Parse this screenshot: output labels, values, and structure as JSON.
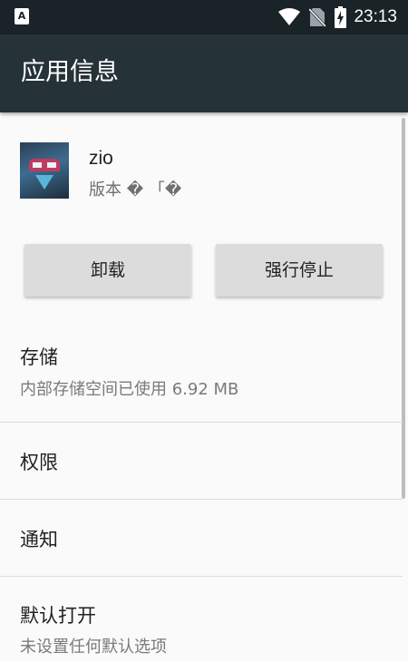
{
  "status_bar": {
    "notification": "A",
    "time": "23:13"
  },
  "app_bar": {
    "title": "应用信息"
  },
  "app": {
    "name": "zio",
    "version": "版本 � 「�"
  },
  "buttons": {
    "uninstall": "卸载",
    "force_stop": "强行停止"
  },
  "sections": {
    "storage": {
      "title": "存储",
      "subtitle": "内部存储空间已使用 6.92 MB"
    },
    "permissions": {
      "title": "权限"
    },
    "notifications": {
      "title": "通知"
    },
    "default_open": {
      "title": "默认打开",
      "subtitle": "未设置任何默认选项"
    }
  },
  "colors": {
    "status_bar": "#1a2328",
    "app_bar": "#253238",
    "background": "#fafafa",
    "button": "#dcdcdc"
  }
}
